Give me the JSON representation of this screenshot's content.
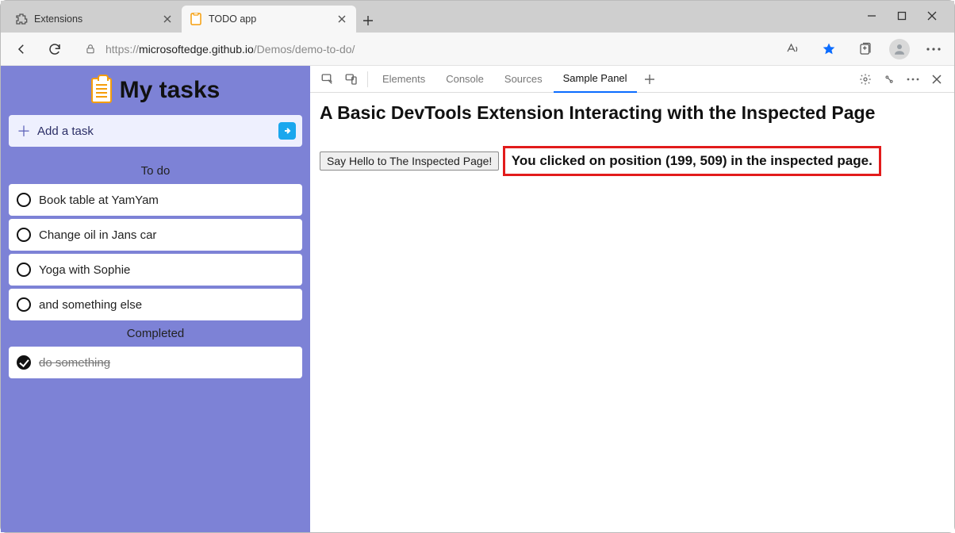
{
  "browser": {
    "tabs": [
      {
        "title": "Extensions",
        "active": false,
        "icon": "extension"
      },
      {
        "title": "TODO app",
        "active": true,
        "icon": "clipboard"
      }
    ],
    "url_host": "microsoftedge.github.io",
    "url_prefix": "https://",
    "url_path": "/Demos/demo-to-do/"
  },
  "app": {
    "title": "My tasks",
    "add_placeholder": "Add a task",
    "sections": {
      "todo_label": "To do",
      "completed_label": "Completed"
    },
    "todo": [
      "Book table at YamYam",
      "Change oil in Jans car",
      "Yoga with Sophie",
      "and something else"
    ],
    "completed": [
      "do something"
    ]
  },
  "devtools": {
    "tabs": [
      "Elements",
      "Console",
      "Sources",
      "Sample Panel"
    ],
    "active_tab": "Sample Panel",
    "panel": {
      "heading": "A Basic DevTools Extension Interacting with the Inspected Page",
      "button_label": "Say Hello to The Inspected Page!",
      "message": "You clicked on position (199, 509) in the inspected page."
    }
  }
}
